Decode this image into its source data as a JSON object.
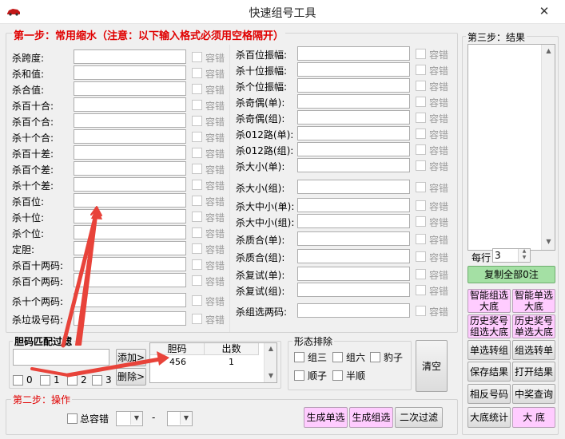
{
  "window": {
    "title": "快速组号工具",
    "close_icon": "close-icon"
  },
  "step1": {
    "legend": "第一步：常用缩水（注意：以下输入格式必须用空格隔开）",
    "checkbox_label": "容错",
    "left_fields": [
      "杀跨度:",
      "杀和值:",
      "杀合值:",
      "杀百十合:",
      "杀百个合:",
      "杀十个合:",
      "杀百十差:",
      "杀百个差:",
      "杀十个差:",
      "杀百位:",
      "杀十位:",
      "杀个位:",
      "定胆:",
      "杀百十两码:",
      "杀百个两码:",
      "杀十个两码:",
      "杀垃圾号码:"
    ],
    "right_fields": [
      "杀百位振幅:",
      "杀十位振幅:",
      "杀个位振幅:",
      "杀奇偶(单):",
      "杀奇偶(组):",
      "杀012路(单):",
      "杀012路(组):",
      "杀大小(单):",
      "杀大小(组):",
      "杀大中小(单):",
      "杀大中小(组):",
      "杀质合(单):",
      "杀质合(组):",
      "杀复试(单):",
      "杀复试(组):",
      "杀组选两码:"
    ]
  },
  "dan_match": {
    "legend": "胆码匹配过滤",
    "add_label": "添加>",
    "delete_label": "删除>",
    "options": [
      "0",
      "1",
      "2",
      "3"
    ],
    "table": {
      "headers": [
        "胆码",
        "出数"
      ],
      "rows": [
        [
          "456",
          "1"
        ]
      ]
    }
  },
  "shape_exclude": {
    "legend": "形态排除",
    "options": [
      "组三",
      "组六",
      "豹子",
      "顺子",
      "半顺"
    ],
    "clear_label": "清空"
  },
  "step2": {
    "legend": "第二步：操作",
    "total_tolerance_label": "总容错",
    "separator": "-",
    "gen_single": "生成单选",
    "gen_group": "生成组选",
    "second_filter": "二次过滤"
  },
  "step3": {
    "legend": "第三步：结果",
    "per_row_label": "每行",
    "per_row_value": "3",
    "copy_all": "复制全部0注",
    "buttons": [
      [
        "智能组选大底",
        "智能单选大底"
      ],
      [
        "历史奖号组选大底",
        "历史奖号单选大底"
      ],
      [
        "单选转组",
        "组选转单"
      ],
      [
        "保存结果",
        "打开结果"
      ],
      [
        "相反号码",
        "中奖查询"
      ],
      [
        "大底统计",
        "大 底"
      ]
    ]
  },
  "colors": {
    "legend_red": "#e00000",
    "pink_button": "#ffccff",
    "green_button": "#a4e0a4",
    "arrow_red": "#e8433a"
  }
}
